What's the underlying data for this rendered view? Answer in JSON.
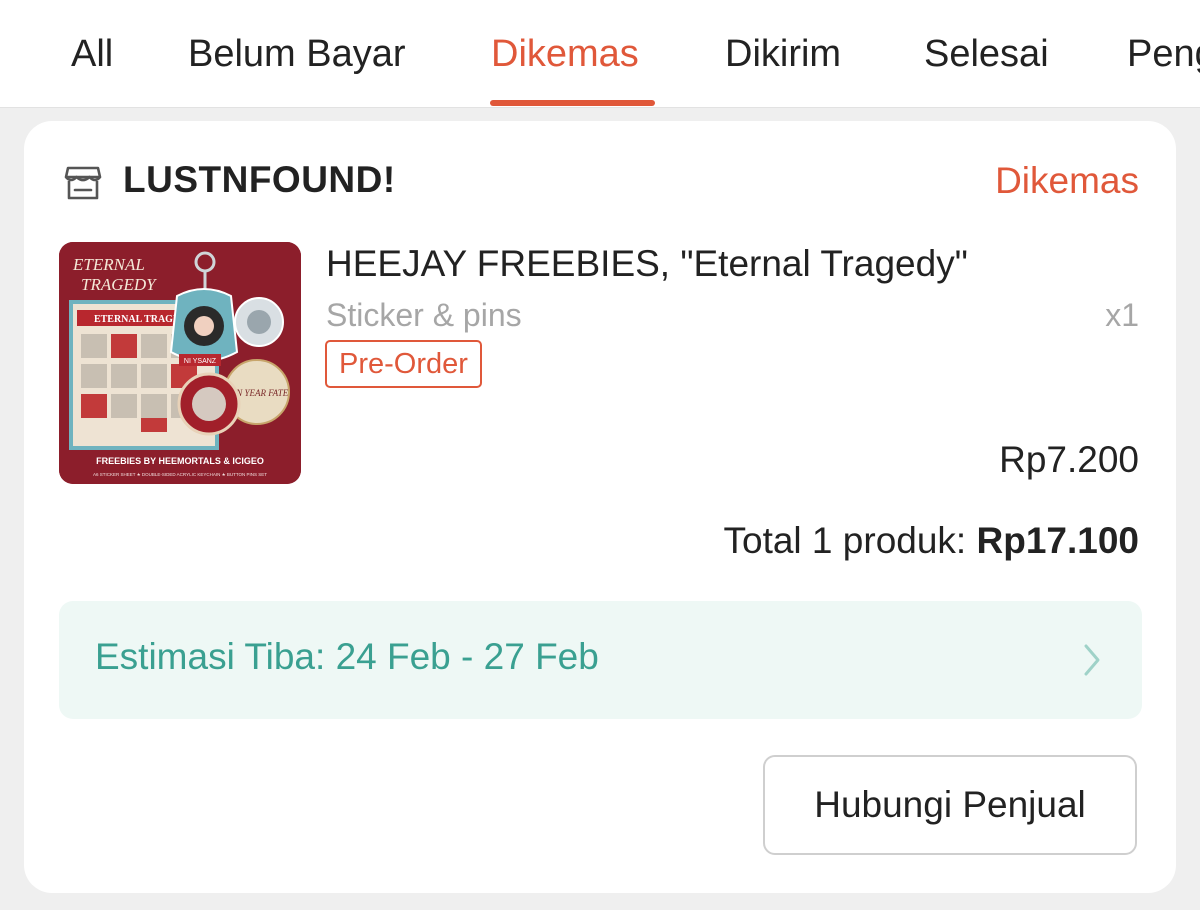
{
  "tabs": [
    {
      "label": "All"
    },
    {
      "label": "Belum Bayar"
    },
    {
      "label": "Dikemas",
      "active": true
    },
    {
      "label": "Dikirim"
    },
    {
      "label": "Selesai"
    },
    {
      "label": "Pengembalian"
    }
  ],
  "order": {
    "shop_name": "LUSTNFOUND!",
    "shop_icon": "store-icon",
    "status": "Dikemas",
    "product": {
      "title": "HEEJAY FREEBIES, \"Eternal Tragedy\"",
      "variant": "Sticker & pins",
      "quantity": "x1",
      "badge": "Pre-Order",
      "price": "Rp7.200",
      "image_text": {
        "title_line1": "ETERNAL",
        "title_line2": "TRAGEDY",
        "sheet_title": "ETERNAL TRAGEDY",
        "badge_text": "TEN YEAR FATE",
        "name_tag": "NI YSANZ",
        "footer": "FREEBIES BY HEEMORTALS & ICIGEO",
        "subfooter": "A6 STICKER SHEET ★ DOUBLE-SIDED ACRYLIC KEYCHAIN ★ BUTTON PINS SET"
      }
    },
    "total_label": "Total 1 produk:",
    "total_value": "Rp17.100",
    "eta": "Estimasi Tiba: 24 Feb - 27 Feb",
    "contact_button": "Hubungi Penjual"
  },
  "colors": {
    "accent": "#e0583a",
    "eta_text": "#3aa091",
    "eta_bg": "#eef8f5",
    "page_bg": "#efefef"
  }
}
